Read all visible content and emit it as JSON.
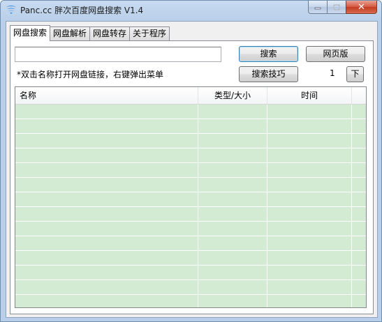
{
  "window": {
    "title": "Panc.cc 胖次百度网盘搜索 V1.4",
    "close_glyph": "✕",
    "minimize_icon": "minimize-icon",
    "maximize_icon": "maximize-icon"
  },
  "tabs": [
    {
      "label": "网盘搜索",
      "active": true
    },
    {
      "label": "网盘解析",
      "active": false
    },
    {
      "label": "网盘转存",
      "active": false
    },
    {
      "label": "关于程序",
      "active": false
    }
  ],
  "search": {
    "value": "",
    "placeholder": "",
    "search_button": "搜索",
    "web_button": "网页版",
    "tips_button": "搜索技巧",
    "hint": "*双击名称打开网盘链接，右键弹出菜单"
  },
  "pagination": {
    "page": "1",
    "next_button": "下"
  },
  "results": {
    "columns": [
      "名称",
      "类型/大小",
      "时间"
    ],
    "rows": []
  },
  "colors": {
    "list_background": "#d3ebd3",
    "title_bar": "#b9cfe9"
  }
}
